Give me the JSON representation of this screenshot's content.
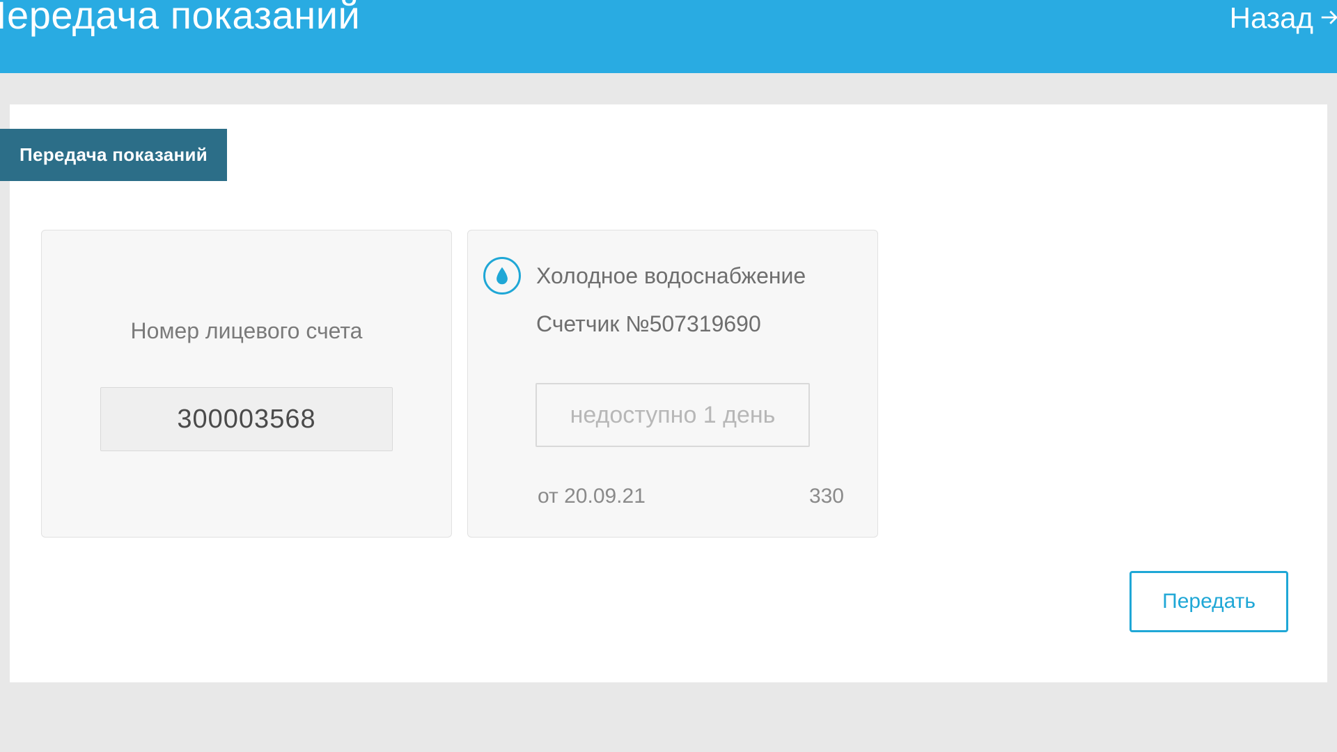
{
  "header": {
    "title": "Іередача показаний",
    "back_label": "Назад"
  },
  "tab": {
    "label": "Передача показаний"
  },
  "account": {
    "label": "Номер лицевого счета",
    "value": "300003568"
  },
  "meter": {
    "service_title": "Холодное водоснабжение",
    "meter_label_prefix": "Счетчик №",
    "meter_number": "507319690",
    "input_placeholder": "недоступно 1 день",
    "last_date_prefix": "от ",
    "last_date": "20.09.21",
    "last_value": "330"
  },
  "actions": {
    "submit_label": "Передать"
  },
  "colors": {
    "accent": "#29abe2",
    "tab": "#2c6e88",
    "outline": "#1fa7d6"
  }
}
